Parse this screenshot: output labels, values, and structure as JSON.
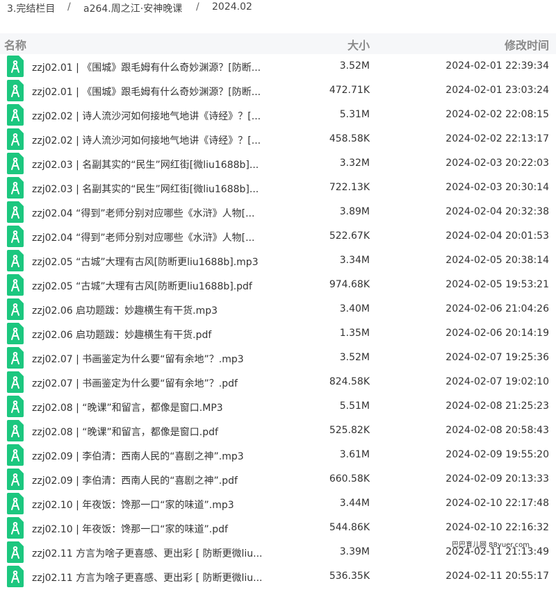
{
  "breadcrumb": {
    "items": [
      "3.完结栏目",
      "a264.周之江·安神晚课",
      "2024.02"
    ],
    "separator": "/"
  },
  "columns": {
    "name": "名称",
    "size": "大小",
    "time": "修改时间"
  },
  "file_icon": {
    "name": "file-audio-pdf-icon",
    "color": "#1cc77f"
  },
  "files": [
    {
      "name": "zzj02.01 | 《围城》跟毛姆有什么奇妙渊源？[防断...",
      "size": "3.52M",
      "time": "2024-02-01 22:39:34"
    },
    {
      "name": "zzj02.01 | 《围城》跟毛姆有什么奇妙渊源？[防断...",
      "size": "472.71K",
      "time": "2024-02-01 23:03:24"
    },
    {
      "name": "zzj02.02 | 诗人流沙河如何接地气地讲《诗经》？[...",
      "size": "5.31M",
      "time": "2024-02-02 22:08:15"
    },
    {
      "name": "zzj02.02 | 诗人流沙河如何接地气地讲《诗经》？[...",
      "size": "458.58K",
      "time": "2024-02-02 22:13:17"
    },
    {
      "name": "zzj02.03 | 名副其实的“民生”网红街[微liu1688b]...",
      "size": "3.32M",
      "time": "2024-02-03 20:22:03"
    },
    {
      "name": "zzj02.03 | 名副其实的“民生”网红街[微liu1688b]...",
      "size": "722.13K",
      "time": "2024-02-03 20:30:14"
    },
    {
      "name": "zzj02.04 “得到”老师分别对应哪些《水浒》人物[...",
      "size": "3.89M",
      "time": "2024-02-04 20:32:38"
    },
    {
      "name": "zzj02.04 “得到”老师分别对应哪些《水浒》人物[...",
      "size": "522.67K",
      "time": "2024-02-04 20:01:53"
    },
    {
      "name": "zzj02.05 “古城”大理有古风[防断更liu1688b].mp3",
      "size": "3.34M",
      "time": "2024-02-05 20:38:14"
    },
    {
      "name": "zzj02.05 “古城”大理有古风[防断更liu1688b].pdf",
      "size": "974.68K",
      "time": "2024-02-05 19:53:21"
    },
    {
      "name": "zzj02.06 启功题跋：妙趣横生有干货.mp3",
      "size": "3.40M",
      "time": "2024-02-06 21:04:26"
    },
    {
      "name": "zzj02.06 启功题跋：妙趣横生有干货.pdf",
      "size": "1.35M",
      "time": "2024-02-06 20:14:19"
    },
    {
      "name": "zzj02.07 | 书画鉴定为什么要“留有余地”？.mp3",
      "size": "3.52M",
      "time": "2024-02-07 19:25:36"
    },
    {
      "name": "zzj02.07 | 书画鉴定为什么要“留有余地”？.pdf",
      "size": "824.58K",
      "time": "2024-02-07 19:02:10"
    },
    {
      "name": "zzj02.08 | “晚课”和留言，都像是窗口.MP3",
      "size": "5.51M",
      "time": "2024-02-08 21:25:23"
    },
    {
      "name": "zzj02.08 | “晚课”和留言，都像是窗口.pdf",
      "size": "525.82K",
      "time": "2024-02-08 20:58:43"
    },
    {
      "name": "zzj02.09 | 李伯清：西南人民的“喜剧之神”.mp3",
      "size": "3.61M",
      "time": "2024-02-09 19:55:20"
    },
    {
      "name": "zzj02.09 | 李伯清：西南人民的“喜剧之神”.pdf",
      "size": "660.58K",
      "time": "2024-02-09 20:13:33"
    },
    {
      "name": "zzj02.10 | 年夜饭：馋那一口“家的味道”.mp3",
      "size": "3.44M",
      "time": "2024-02-10 22:17:48"
    },
    {
      "name": "zzj02.10 | 年夜饭：馋那一口“家的味道”.pdf",
      "size": "544.86K",
      "time": "2024-02-10 22:16:32"
    },
    {
      "name": "zzj02.11 方言为啥子更喜感、更出彩 [ 防断更微liu...",
      "size": "3.39M",
      "time": "2024-02-11 21:13:49"
    },
    {
      "name": "zzj02.11 方言为啥子更喜感、更出彩 [ 防断更微liu...",
      "size": "536.35K",
      "time": "2024-02-11 20:55:17"
    }
  ],
  "watermark": "巴巴育儿网 88yuer.com"
}
